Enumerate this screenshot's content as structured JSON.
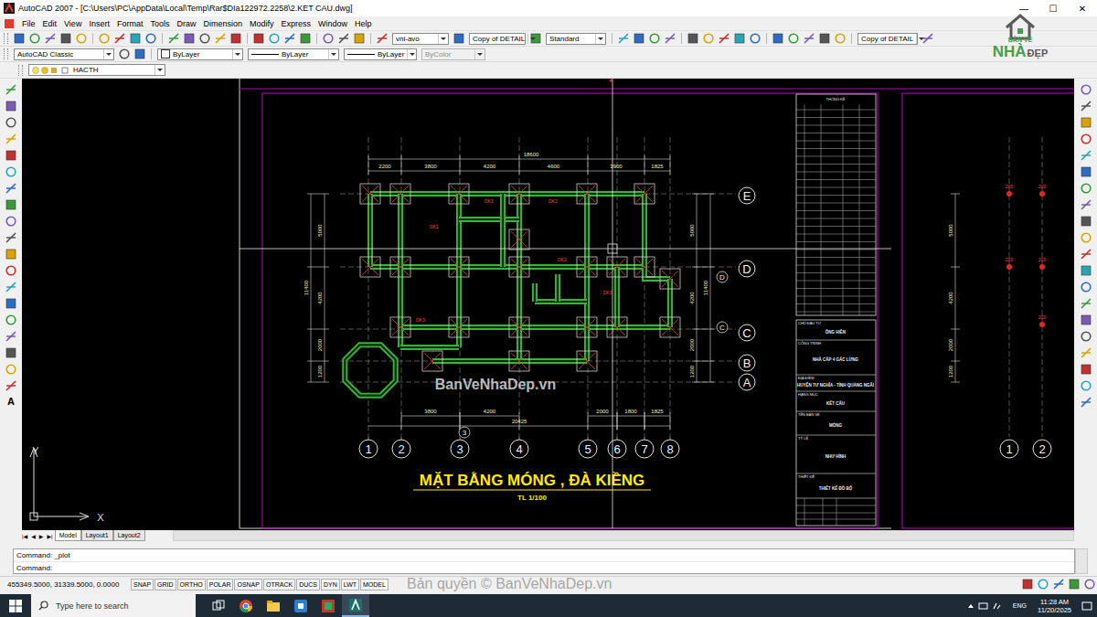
{
  "window": {
    "title": "AutoCAD 2007 - [C:\\Users\\PC\\AppData\\Local\\Temp\\Rar$DIa122972.2258\\2.KET CAU.dwg]",
    "controls": [
      "—",
      "☐",
      "✕"
    ]
  },
  "logo": {
    "top": "BẢN VẼ",
    "brand": "NHÀ",
    "accent": "ĐẸP"
  },
  "menu": [
    "File",
    "Edit",
    "View",
    "Insert",
    "Format",
    "Tools",
    "Draw",
    "Dimension",
    "Modify",
    "Express",
    "Window",
    "Help"
  ],
  "toolbar": {
    "text_style": "vni-avo",
    "dim_style": "Copy of DETAIL",
    "table_style": "Standard",
    "dim_style_2": "Copy of DETAIL"
  },
  "properties": {
    "workspace": "AutoCAD Classic",
    "layer": "HACTH",
    "color": "ByLayer",
    "linetype": "ByLayer",
    "lineweight": "ByLayer",
    "plot_style": "ByColor",
    "plot_style_disabled": true
  },
  "draw_toolbar": {
    "text_tool": "A"
  },
  "drawing": {
    "axes_x": [
      "1",
      "2",
      "3",
      "4",
      "5",
      "6",
      "7",
      "8"
    ],
    "axes_y": [
      "E",
      "D",
      "C",
      "B",
      "A"
    ],
    "minor_bubbles": [
      "3",
      "D",
      "C"
    ],
    "dims_top": [
      "2200",
      "3800",
      "4200",
      "4600",
      "3900",
      "1825"
    ],
    "dim_top_total": "18600",
    "dims_bottom": [
      "3800",
      "4200",
      "2000",
      "1800",
      "1825"
    ],
    "dim_bottom_total": "20425",
    "dims_left": [
      "5000",
      "4200",
      "2000",
      "1200"
    ],
    "dim_left_total": "11400",
    "dims_right": [
      "5000",
      "4200",
      "2000",
      "1200"
    ],
    "dim_right_total": "11400",
    "beam_labels": [
      "DK1",
      "DK1",
      "DK2",
      "DK2",
      "DK3",
      "DK1"
    ],
    "title": "MẶT BẰNG MÓNG , ĐÀ KIỀNG",
    "scale": "TL 1/100",
    "watermark": "BanVeNhaDep.vn",
    "table_header": "THỐNG KÊ",
    "title_block": [
      {
        "label": "CHỦ ĐẦU TƯ",
        "value": "ÔNG HIỀN"
      },
      {
        "label": "CÔNG TRÌNH",
        "value": "NHÀ CẤP 4 GÁC LỬNG"
      },
      {
        "label": "ĐỊA ĐIỂM",
        "value": "HUYỆN TƯ NGHĨA - TỈNH QUẢNG NGÃI"
      },
      {
        "label": "HẠNG MỤC",
        "value": "KẾT CẤU"
      },
      {
        "label": "TÊN BẢN VẼ",
        "value": "MÓNG"
      },
      {
        "label": "TỶ LỆ",
        "value": "NHƯ HÌNH"
      },
      {
        "label": "THIẾT KẾ",
        "value": "THIẾT KẾ ĐỒ BỘ"
      }
    ],
    "ucs": {
      "x": "X",
      "y": "Y"
    }
  },
  "right_sheet": {
    "axes": [
      "1",
      "2"
    ],
    "dims": [
      "5000",
      "4200",
      "2000",
      "1200"
    ],
    "footing_labels": [
      "200",
      "200",
      "200",
      "200",
      "200"
    ]
  },
  "layout_tabs": [
    {
      "label": "Model",
      "selected": true
    },
    {
      "label": "Layout1",
      "selected": false
    },
    {
      "label": "Layout2",
      "selected": false
    }
  ],
  "nav_arrows": [
    "|◀",
    "◀",
    "▶",
    "▶|"
  ],
  "command_lines": [
    "Command: _plot",
    "Command:"
  ],
  "status_bar": {
    "coords": "455349.5000, 31339.5000, 0.0000",
    "toggles": [
      {
        "label": "SNAP",
        "on": false
      },
      {
        "label": "GRID",
        "on": false
      },
      {
        "label": "ORTHO",
        "on": false
      },
      {
        "label": "POLAR",
        "on": false
      },
      {
        "label": "OSNAP",
        "on": false
      },
      {
        "label": "OTRACK",
        "on": false
      },
      {
        "label": "DUCS",
        "on": false
      },
      {
        "label": "DYN",
        "on": false
      },
      {
        "label": "LWT",
        "on": false
      },
      {
        "label": "MODEL",
        "on": false
      }
    ]
  },
  "taskbar": {
    "search_placeholder": "Type here to search",
    "language": "ENG",
    "time": "11:28 AM",
    "date": "11/20/2025"
  },
  "copyright": "Bản quyền © BanVeNhaDep.vn"
}
